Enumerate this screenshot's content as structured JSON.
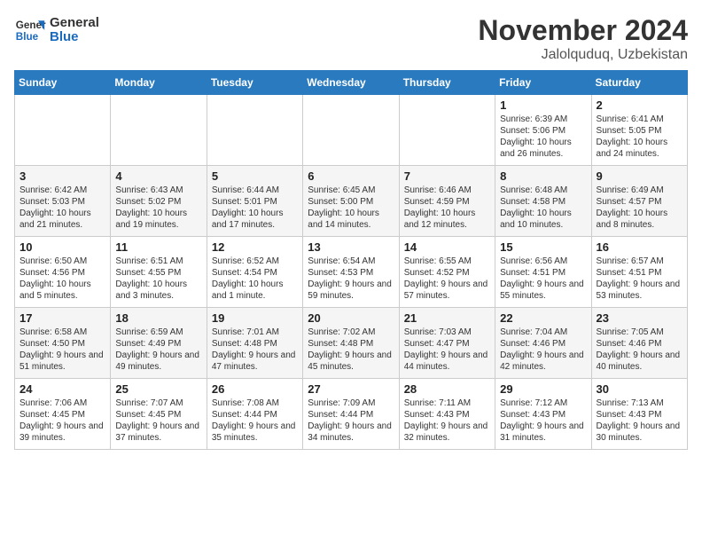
{
  "header": {
    "logo_general": "General",
    "logo_blue": "Blue",
    "title": "November 2024",
    "location": "Jalolquduq, Uzbekistan"
  },
  "weekdays": [
    "Sunday",
    "Monday",
    "Tuesday",
    "Wednesday",
    "Thursday",
    "Friday",
    "Saturday"
  ],
  "weeks": [
    [
      {
        "day": "",
        "info": ""
      },
      {
        "day": "",
        "info": ""
      },
      {
        "day": "",
        "info": ""
      },
      {
        "day": "",
        "info": ""
      },
      {
        "day": "",
        "info": ""
      },
      {
        "day": "1",
        "info": "Sunrise: 6:39 AM\nSunset: 5:06 PM\nDaylight: 10 hours and 26 minutes."
      },
      {
        "day": "2",
        "info": "Sunrise: 6:41 AM\nSunset: 5:05 PM\nDaylight: 10 hours and 24 minutes."
      }
    ],
    [
      {
        "day": "3",
        "info": "Sunrise: 6:42 AM\nSunset: 5:03 PM\nDaylight: 10 hours and 21 minutes."
      },
      {
        "day": "4",
        "info": "Sunrise: 6:43 AM\nSunset: 5:02 PM\nDaylight: 10 hours and 19 minutes."
      },
      {
        "day": "5",
        "info": "Sunrise: 6:44 AM\nSunset: 5:01 PM\nDaylight: 10 hours and 17 minutes."
      },
      {
        "day": "6",
        "info": "Sunrise: 6:45 AM\nSunset: 5:00 PM\nDaylight: 10 hours and 14 minutes."
      },
      {
        "day": "7",
        "info": "Sunrise: 6:46 AM\nSunset: 4:59 PM\nDaylight: 10 hours and 12 minutes."
      },
      {
        "day": "8",
        "info": "Sunrise: 6:48 AM\nSunset: 4:58 PM\nDaylight: 10 hours and 10 minutes."
      },
      {
        "day": "9",
        "info": "Sunrise: 6:49 AM\nSunset: 4:57 PM\nDaylight: 10 hours and 8 minutes."
      }
    ],
    [
      {
        "day": "10",
        "info": "Sunrise: 6:50 AM\nSunset: 4:56 PM\nDaylight: 10 hours and 5 minutes."
      },
      {
        "day": "11",
        "info": "Sunrise: 6:51 AM\nSunset: 4:55 PM\nDaylight: 10 hours and 3 minutes."
      },
      {
        "day": "12",
        "info": "Sunrise: 6:52 AM\nSunset: 4:54 PM\nDaylight: 10 hours and 1 minute."
      },
      {
        "day": "13",
        "info": "Sunrise: 6:54 AM\nSunset: 4:53 PM\nDaylight: 9 hours and 59 minutes."
      },
      {
        "day": "14",
        "info": "Sunrise: 6:55 AM\nSunset: 4:52 PM\nDaylight: 9 hours and 57 minutes."
      },
      {
        "day": "15",
        "info": "Sunrise: 6:56 AM\nSunset: 4:51 PM\nDaylight: 9 hours and 55 minutes."
      },
      {
        "day": "16",
        "info": "Sunrise: 6:57 AM\nSunset: 4:51 PM\nDaylight: 9 hours and 53 minutes."
      }
    ],
    [
      {
        "day": "17",
        "info": "Sunrise: 6:58 AM\nSunset: 4:50 PM\nDaylight: 9 hours and 51 minutes."
      },
      {
        "day": "18",
        "info": "Sunrise: 6:59 AM\nSunset: 4:49 PM\nDaylight: 9 hours and 49 minutes."
      },
      {
        "day": "19",
        "info": "Sunrise: 7:01 AM\nSunset: 4:48 PM\nDaylight: 9 hours and 47 minutes."
      },
      {
        "day": "20",
        "info": "Sunrise: 7:02 AM\nSunset: 4:48 PM\nDaylight: 9 hours and 45 minutes."
      },
      {
        "day": "21",
        "info": "Sunrise: 7:03 AM\nSunset: 4:47 PM\nDaylight: 9 hours and 44 minutes."
      },
      {
        "day": "22",
        "info": "Sunrise: 7:04 AM\nSunset: 4:46 PM\nDaylight: 9 hours and 42 minutes."
      },
      {
        "day": "23",
        "info": "Sunrise: 7:05 AM\nSunset: 4:46 PM\nDaylight: 9 hours and 40 minutes."
      }
    ],
    [
      {
        "day": "24",
        "info": "Sunrise: 7:06 AM\nSunset: 4:45 PM\nDaylight: 9 hours and 39 minutes."
      },
      {
        "day": "25",
        "info": "Sunrise: 7:07 AM\nSunset: 4:45 PM\nDaylight: 9 hours and 37 minutes."
      },
      {
        "day": "26",
        "info": "Sunrise: 7:08 AM\nSunset: 4:44 PM\nDaylight: 9 hours and 35 minutes."
      },
      {
        "day": "27",
        "info": "Sunrise: 7:09 AM\nSunset: 4:44 PM\nDaylight: 9 hours and 34 minutes."
      },
      {
        "day": "28",
        "info": "Sunrise: 7:11 AM\nSunset: 4:43 PM\nDaylight: 9 hours and 32 minutes."
      },
      {
        "day": "29",
        "info": "Sunrise: 7:12 AM\nSunset: 4:43 PM\nDaylight: 9 hours and 31 minutes."
      },
      {
        "day": "30",
        "info": "Sunrise: 7:13 AM\nSunset: 4:43 PM\nDaylight: 9 hours and 30 minutes."
      }
    ]
  ]
}
